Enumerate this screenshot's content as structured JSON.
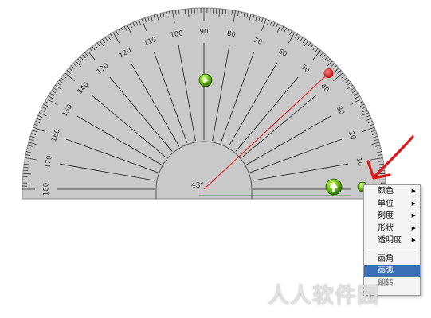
{
  "protractor": {
    "scale_labels": [
      "0",
      "10",
      "20",
      "30",
      "40",
      "50",
      "60",
      "70",
      "80",
      "90",
      "100",
      "110",
      "120",
      "130",
      "140",
      "150",
      "160",
      "170",
      "180"
    ],
    "angle_readout": "43°",
    "measured_angle_deg": 43,
    "colors": {
      "body": "#c9c9c9",
      "edge": "#9c9c9c",
      "tick": "#1e1e1e",
      "angle_line": "#e01818",
      "base_line": "#2fa33a",
      "handle": "#e01818"
    }
  },
  "context_menu": {
    "items": [
      {
        "label": "颜色",
        "has_submenu": true
      },
      {
        "label": "单位",
        "has_submenu": true
      },
      {
        "label": "刻度",
        "has_submenu": true
      },
      {
        "label": "形状",
        "has_submenu": true
      },
      {
        "label": "透明度",
        "has_submenu": true
      },
      {
        "label": "画角",
        "has_submenu": false
      },
      {
        "label": "画弧",
        "has_submenu": false,
        "selected": true
      },
      {
        "label": "翻转",
        "has_submenu": false
      }
    ]
  },
  "annotation": {
    "arrow_color": "#e01818"
  },
  "watermark": {
    "text": "人人软件园"
  },
  "icons": [
    "rotate-knob-icon",
    "move-knob-icon",
    "small-green-knob-icon",
    "red-arrow-annotation",
    "submenu-arrow-icon"
  ]
}
